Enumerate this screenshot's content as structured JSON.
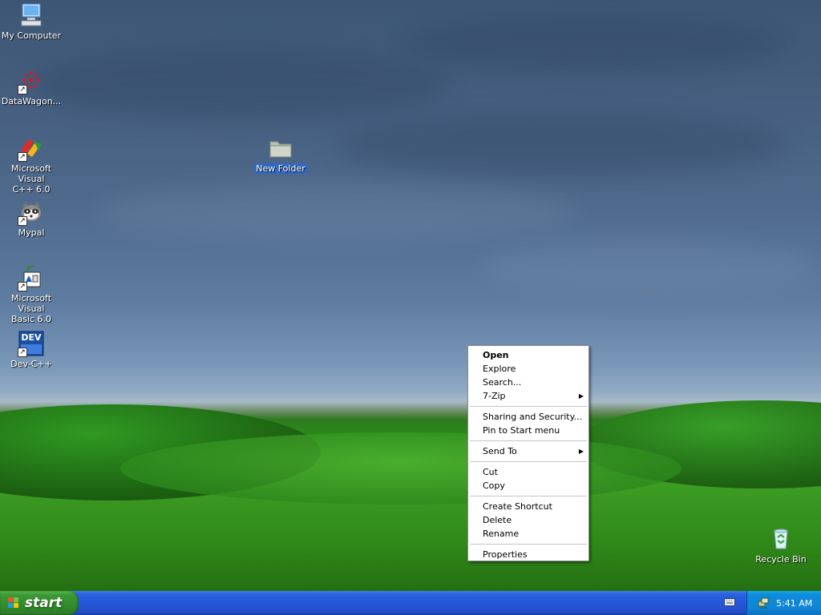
{
  "desktop": {
    "icons": [
      {
        "label_lines": [
          "My Computer"
        ],
        "icon": "computer-icon",
        "shortcut": false
      },
      {
        "label_lines": [
          "DataWagon..."
        ],
        "icon": "datawagon-icon",
        "shortcut": true
      },
      {
        "label_lines": [
          "Microsoft Visual",
          "C++ 6.0"
        ],
        "icon": "visual-cpp-icon",
        "shortcut": true
      },
      {
        "label_lines": [
          "Mypal"
        ],
        "icon": "raccoon-icon",
        "shortcut": true
      },
      {
        "label_lines": [
          "Microsoft Visual",
          "Basic 6.0"
        ],
        "icon": "visual-basic-icon",
        "shortcut": true
      },
      {
        "label_lines": [
          "Dev-C++"
        ],
        "icon": "devcpp-icon",
        "shortcut": true,
        "glyph_text": "DEV"
      }
    ],
    "new_folder": {
      "label": "New Folder",
      "icon": "folder-icon",
      "selected": true
    },
    "recycle_bin": {
      "label": "Recycle Bin",
      "icon": "recycle-bin-icon"
    }
  },
  "context_menu": {
    "groups": [
      [
        {
          "label": "Open",
          "bold": true
        },
        {
          "label": "Explore"
        },
        {
          "label": "Search..."
        },
        {
          "label": "7-Zip",
          "submenu": true
        }
      ],
      [
        {
          "label": "Sharing and Security..."
        },
        {
          "label": "Pin to Start menu"
        }
      ],
      [
        {
          "label": "Send To",
          "submenu": true
        }
      ],
      [
        {
          "label": "Cut"
        },
        {
          "label": "Copy"
        }
      ],
      [
        {
          "label": "Create Shortcut"
        },
        {
          "label": "Delete"
        },
        {
          "label": "Rename"
        }
      ],
      [
        {
          "label": "Properties"
        }
      ]
    ],
    "submenu_glyph": "▶"
  },
  "taskbar": {
    "start_label": "start",
    "tray_keyboard_icon": "keyboard-icon",
    "tray_network_icon": "network-icon",
    "clock": "5:41 AM"
  },
  "colors": {
    "selection": "#3169c6",
    "taskbar": "#2657d8",
    "start_button": "#328a2d",
    "tray": "#0f86d6"
  }
}
